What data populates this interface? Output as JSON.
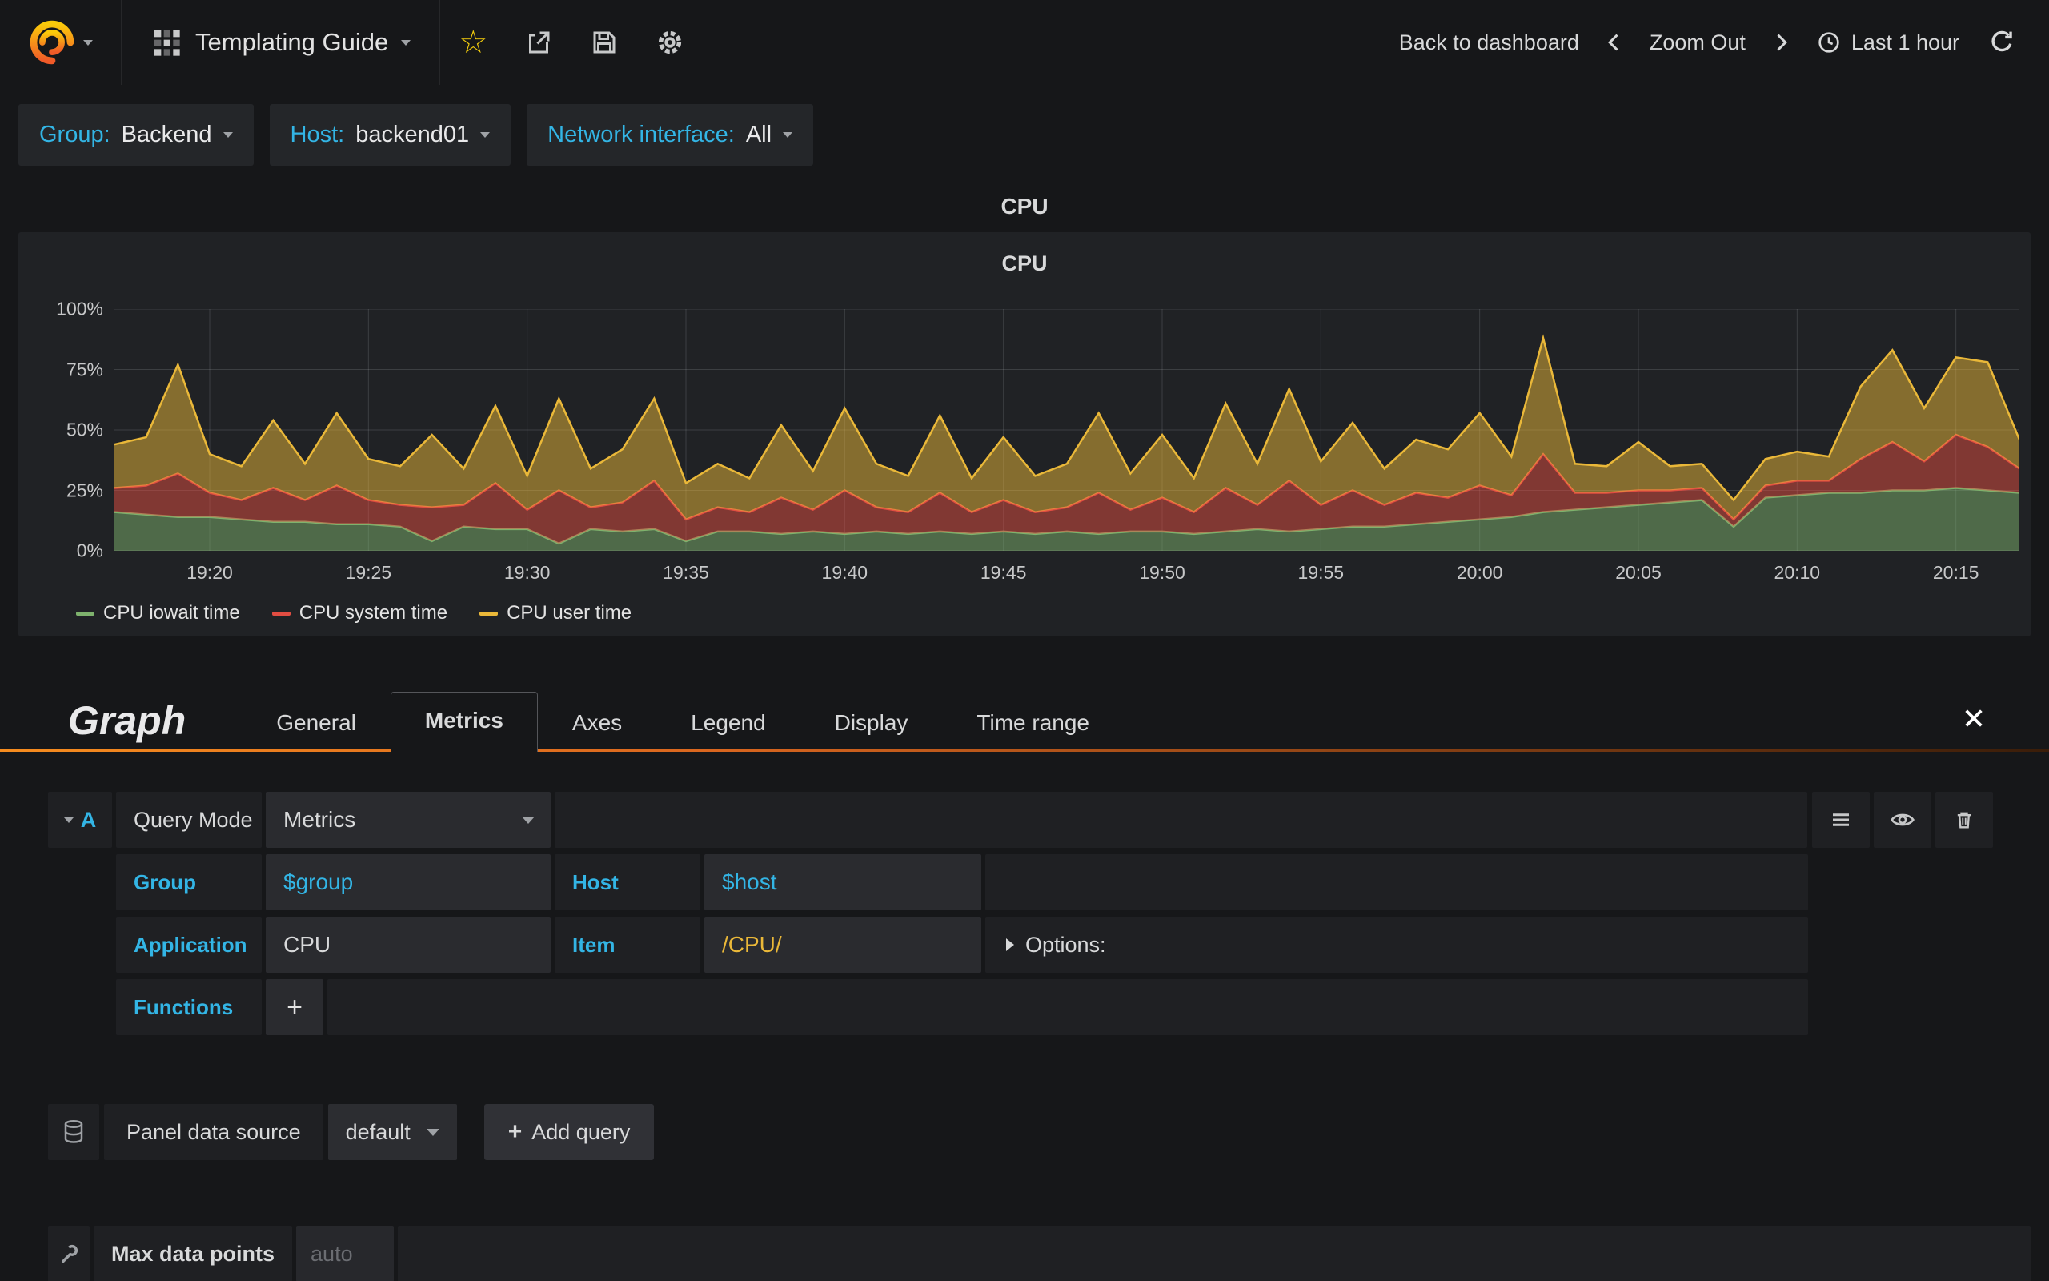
{
  "colors": {
    "accent_blue": "#33b5e5",
    "accent_orange": "#eb7b18",
    "star_yellow": "#f2cc0c",
    "value_yellow": "#eab839",
    "text_primary": "#d8d9da",
    "bg_body": "#161719"
  },
  "navbar": {
    "dashboard_title": "Templating Guide",
    "back_to_dashboard": "Back to dashboard",
    "zoom_out": "Zoom Out",
    "time_range": "Last 1 hour"
  },
  "variables": [
    {
      "label": "Group:",
      "value": "Backend"
    },
    {
      "label": "Host:",
      "value": "backend01"
    },
    {
      "label": "Network interface:",
      "value": "All"
    }
  ],
  "panel": {
    "title": "CPU",
    "chart_title": "CPU"
  },
  "chart_data": {
    "type": "area",
    "stacked": true,
    "title": "CPU",
    "xlabel": "",
    "ylabel": "",
    "ylim": [
      0,
      100
    ],
    "grid": true,
    "legend_position": "bottom",
    "y_ticks": [
      "0%",
      "25%",
      "50%",
      "75%",
      "100%"
    ],
    "x_ticks": [
      "19:20",
      "19:25",
      "19:30",
      "19:35",
      "19:40",
      "19:45",
      "19:50",
      "19:55",
      "20:00",
      "20:05",
      "20:10",
      "20:15"
    ],
    "x_times": [
      "19:17",
      "19:18",
      "19:19",
      "19:20",
      "19:21",
      "19:22",
      "19:23",
      "19:24",
      "19:25",
      "19:26",
      "19:27",
      "19:28",
      "19:29",
      "19:30",
      "19:31",
      "19:32",
      "19:33",
      "19:34",
      "19:35",
      "19:36",
      "19:37",
      "19:38",
      "19:39",
      "19:40",
      "19:41",
      "19:42",
      "19:43",
      "19:44",
      "19:45",
      "19:46",
      "19:47",
      "19:48",
      "19:49",
      "19:50",
      "19:51",
      "19:52",
      "19:53",
      "19:54",
      "19:55",
      "19:56",
      "19:57",
      "19:58",
      "19:59",
      "20:00",
      "20:01",
      "20:02",
      "20:03",
      "20:04",
      "20:05",
      "20:06",
      "20:07",
      "20:08",
      "20:09",
      "20:10",
      "20:11",
      "20:12",
      "20:13",
      "20:14",
      "20:15",
      "20:16",
      "20:17"
    ],
    "series": [
      {
        "name": "CPU iowait time",
        "color": "#7eb26d",
        "values": [
          16,
          15,
          14,
          14,
          13,
          12,
          12,
          11,
          11,
          10,
          4,
          10,
          9,
          9,
          3,
          9,
          8,
          9,
          4,
          8,
          8,
          7,
          8,
          7,
          8,
          7,
          8,
          7,
          8,
          7,
          8,
          7,
          8,
          8,
          7,
          8,
          9,
          8,
          9,
          10,
          10,
          11,
          12,
          13,
          14,
          16,
          17,
          18,
          19,
          20,
          21,
          10,
          22,
          23,
          24,
          24,
          25,
          25,
          26,
          25,
          24
        ]
      },
      {
        "name": "CPU system time",
        "color": "#e24d42",
        "values": [
          10,
          12,
          18,
          10,
          8,
          14,
          9,
          16,
          10,
          9,
          14,
          9,
          19,
          8,
          22,
          9,
          12,
          20,
          9,
          10,
          8,
          15,
          9,
          18,
          10,
          9,
          16,
          9,
          13,
          9,
          10,
          17,
          9,
          14,
          9,
          18,
          10,
          21,
          10,
          15,
          9,
          13,
          10,
          14,
          9,
          24,
          7,
          6,
          6,
          5,
          5,
          3,
          5,
          6,
          5,
          14,
          20,
          12,
          22,
          18,
          10
        ]
      },
      {
        "name": "CPU user time",
        "color": "#eab839",
        "values": [
          18,
          20,
          45,
          16,
          14,
          28,
          15,
          30,
          17,
          16,
          30,
          15,
          32,
          14,
          38,
          16,
          22,
          34,
          15,
          18,
          14,
          30,
          16,
          34,
          18,
          15,
          32,
          14,
          26,
          15,
          18,
          33,
          15,
          26,
          14,
          35,
          17,
          38,
          18,
          28,
          15,
          22,
          20,
          30,
          16,
          48,
          12,
          11,
          20,
          10,
          10,
          8,
          11,
          12,
          10,
          30,
          38,
          22,
          32,
          35,
          12
        ]
      }
    ]
  },
  "editor": {
    "panel_type": "Graph",
    "tabs": [
      "General",
      "Metrics",
      "Axes",
      "Legend",
      "Display",
      "Time range"
    ],
    "active_tab": "Metrics",
    "query": {
      "ref_id": "A",
      "mode_label": "Query Mode",
      "mode_value": "Metrics",
      "group_label": "Group",
      "group_value": "$group",
      "host_label": "Host",
      "host_value": "$host",
      "application_label": "Application",
      "application_value": "CPU",
      "item_label": "Item",
      "item_value": "/CPU/",
      "options_label": "Options:",
      "functions_label": "Functions",
      "add_function": "+"
    },
    "datasource": {
      "label": "Panel data source",
      "value": "default",
      "plus": "+",
      "add_query_label": "Add query"
    },
    "metrics_options": {
      "max_data_points_label": "Max data points",
      "max_data_points_placeholder": "auto"
    }
  }
}
